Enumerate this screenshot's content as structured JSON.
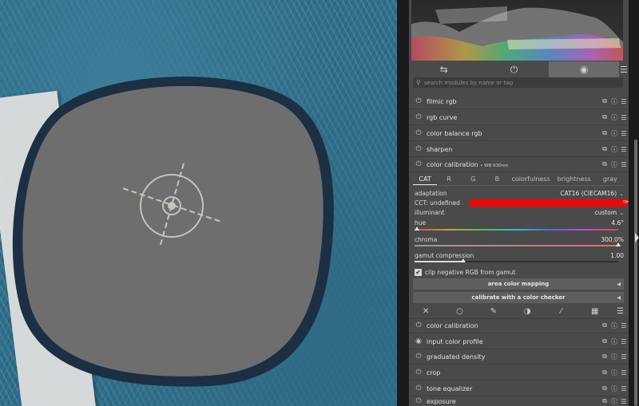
{
  "search": {
    "placeholder": "search modules by name or tag"
  },
  "module_groups": [
    {
      "name": "sliders-icon",
      "glyph": "⇆"
    },
    {
      "name": "power-icon",
      "glyph": "⏻"
    },
    {
      "name": "active-pipe-icon",
      "glyph": "◉"
    }
  ],
  "groups_menu_glyph": "☰",
  "modules_top": [
    {
      "label": "filmic rgb"
    },
    {
      "label": "rgb curve"
    },
    {
      "label": "color balance rgb"
    },
    {
      "label": "sharpen"
    }
  ],
  "color_calibration": {
    "label": "color calibration",
    "instance": "• WB 630nm",
    "tabs": [
      "CAT",
      "R",
      "G",
      "B",
      "colorfulness",
      "brightness",
      "gray"
    ],
    "active_tab": "CAT",
    "adaptation": {
      "label": "adaptation",
      "value": "CAT16 (CIECAM16)"
    },
    "cct": {
      "label": "CCT: undefined",
      "swatch_color": "#ff0000"
    },
    "illuminant": {
      "label": "illuminant",
      "value": "custom"
    },
    "hue": {
      "label": "hue",
      "value": "4.6°",
      "level": 0.013
    },
    "chroma": {
      "label": "chroma",
      "value": "300.0%",
      "level": 1.0
    },
    "gamut_compression": {
      "label": "gamut compression",
      "value": "1.00",
      "level": 0.24
    },
    "clip_negative": {
      "label": "clip negative RGB from gamut",
      "checked": true
    },
    "area_mapping": "area color mapping",
    "calibrate_checker": "calibrate with a color checker"
  },
  "bottom_toolbar": [
    {
      "name": "close-icon",
      "glyph": "✕"
    },
    {
      "name": "circle-mask-icon",
      "glyph": "○"
    },
    {
      "name": "brush-icon",
      "glyph": "✎"
    },
    {
      "name": "parametric-mask-icon",
      "glyph": "◑"
    },
    {
      "name": "drawn-parametric-icon",
      "glyph": "⁄"
    },
    {
      "name": "raster-mask-icon",
      "glyph": "▦"
    },
    {
      "name": "menu-icon",
      "glyph": "☰"
    }
  ],
  "modules_bottom": [
    {
      "label": "color calibration",
      "icon": "⏻"
    },
    {
      "label": "input color profile",
      "icon": "◉"
    },
    {
      "label": "graduated density",
      "icon": "⏻"
    },
    {
      "label": "crop",
      "icon": "⏻"
    },
    {
      "label": "tone equalizer",
      "icon": "⏻"
    },
    {
      "label": "exposure",
      "icon": "⏻"
    }
  ],
  "module_header_icons": {
    "presets": "⧉",
    "reset": "ⓘ",
    "menu": "☰",
    "power": "⏻"
  },
  "colors": {
    "panel_bg": "#4a4a4a",
    "cct_swatch": "#ff0000",
    "active_group": "#6a6a6a"
  }
}
